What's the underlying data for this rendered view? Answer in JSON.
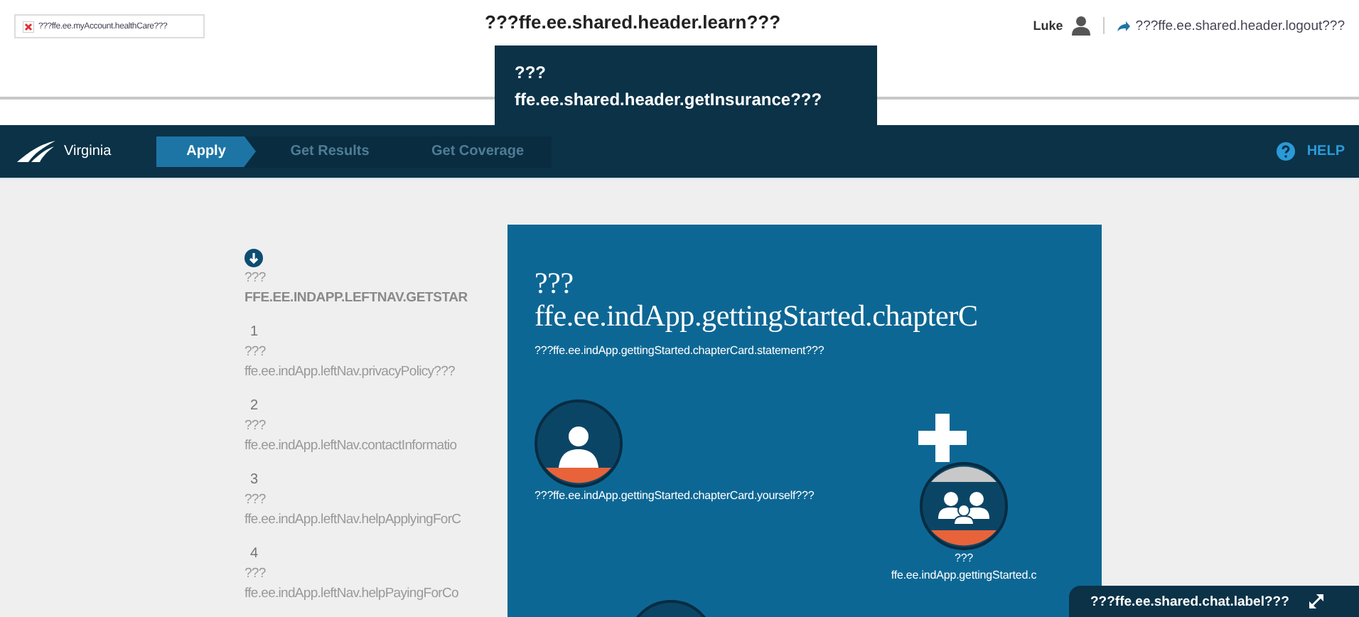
{
  "header": {
    "broken_image": {
      "alt": "???ffe.ee.myAccount.healthCare???"
    },
    "learn_link": "???ffe.ee.shared.header.learn???",
    "user_name": "Luke",
    "logout_link": "???ffe.ee.shared.header.logout???",
    "menu": {
      "lines": [
        "???",
        "ffe.ee.shared.header.getInsurance???"
      ]
    }
  },
  "nav": {
    "state_name": "Virginia",
    "steps": [
      {
        "label": "Apply",
        "selected": true
      },
      {
        "label": "Get Results",
        "selected": false
      },
      {
        "label": "Get Coverage",
        "selected": false
      }
    ],
    "help": "HELP"
  },
  "left_nav": {
    "items": [
      {
        "kind": "icon",
        "prefix": "???",
        "title": "FFE.EE.INDAPP.LEFTNAV.GETSTAR"
      },
      {
        "kind": "number",
        "number": "1",
        "prefix": "???",
        "title": "ffe.ee.indApp.leftNav.privacyPolicy???"
      },
      {
        "kind": "number",
        "number": "2",
        "prefix": "???",
        "title": "ffe.ee.indApp.leftNav.contactInformatio"
      },
      {
        "kind": "number",
        "number": "3",
        "prefix": "???",
        "title": "ffe.ee.indApp.leftNav.helpApplyingForC"
      },
      {
        "kind": "number",
        "number": "4",
        "prefix": "???",
        "title": "ffe.ee.indApp.leftNav.helpPayingForCo"
      }
    ]
  },
  "card": {
    "title_lines": [
      "???",
      "ffe.ee.indApp.gettingStarted.chapterC"
    ],
    "statement": "???ffe.ee.indApp.gettingStarted.chapterCard.statement???",
    "options": [
      {
        "kind": "yourself",
        "label_lines": [
          "???ffe.ee.indApp.gettingStarted.chapterCard.yourself???"
        ]
      },
      {
        "kind": "family",
        "label_lines": [
          "???",
          "ffe.ee.indApp.gettingStarted.c"
        ]
      },
      {
        "kind": "other"
      }
    ]
  },
  "chat": {
    "label": "???ffe.ee.shared.chat.label???"
  }
}
